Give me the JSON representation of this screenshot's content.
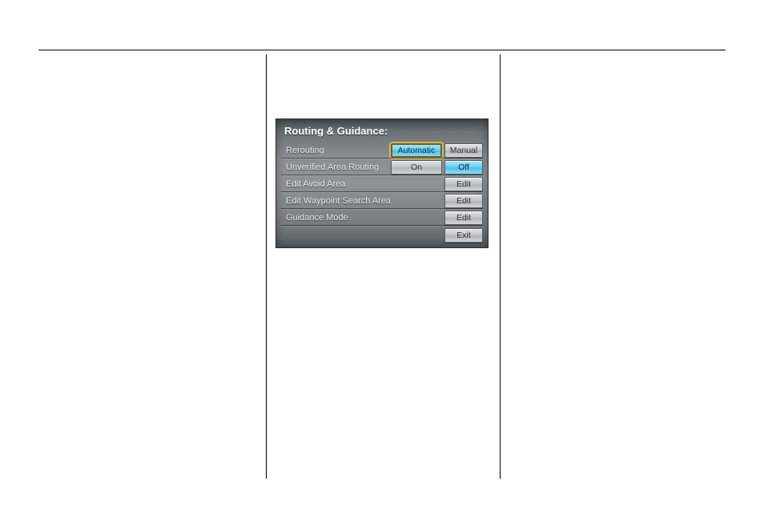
{
  "panel": {
    "title": "Routing & Guidance:"
  },
  "rows": {
    "rerouting": {
      "label": "Rerouting",
      "automatic": "Automatic",
      "manual": "Manual"
    },
    "unverified": {
      "label": "Unverified Area Routing",
      "on": "On",
      "off": "Off"
    },
    "avoid": {
      "label": "Edit Avoid Area",
      "edit": "Edit"
    },
    "waypoint": {
      "label": "Edit Waypoint Search Area",
      "edit": "Edit"
    },
    "guidance": {
      "label": "Guidance Mode",
      "edit": "Edit"
    }
  },
  "footer": {
    "exit": "Exit"
  }
}
